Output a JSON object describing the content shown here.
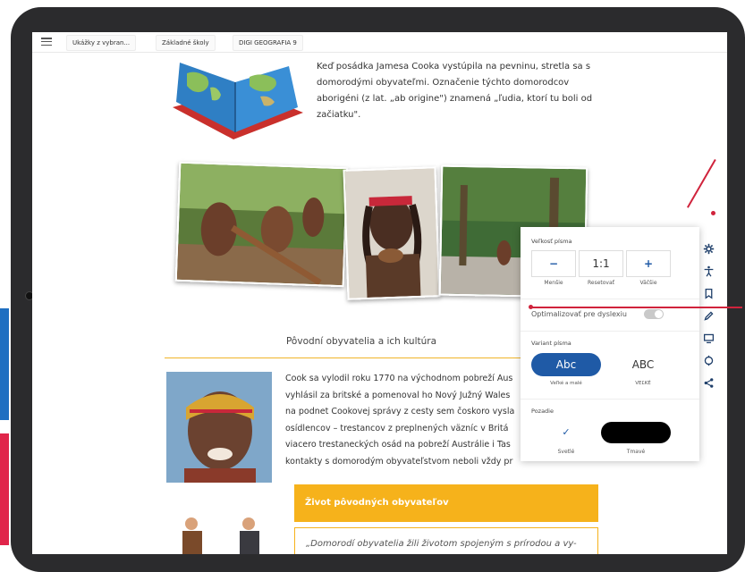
{
  "topbar": {
    "tabs": [
      "Ukážky z vybran...",
      "Základné školy",
      "DIGI GEOGRAFIA 9"
    ]
  },
  "intro": {
    "text": "Keď posádka Jamesa Cooka vystúpila na pevninu, stretla sa s domorodými obyvateľmi. Označenie týchto domorodcov aborigéni (z lat. „ab origine\") znamená „ľudia, ktorí tu boli od začiatku\"."
  },
  "section": {
    "title": "Pôvodní obyvatelia a ich kultúra",
    "body_lines": [
      "Cook sa vylodil roku 1770 na východnom pobreží Aus",
      "vyhlásil za britské a pomenoval ho Nový Južný Wales",
      "na podnet Cookovej správy z cesty sem čoskoro vysla",
      "osídlencov – trestancov z preplnených väzníc v Britá",
      "viacero trestaneckých osád na pobreží Austrálie i Tas",
      "kontakty s domorodým obyvateľstvom neboli vždy pr"
    ]
  },
  "highlight": {
    "title": "Život pôvodných obyvateľov",
    "quote": "„Domorodí obyvatelia žili životom spojeným s prírodou a vy-"
  },
  "settings_panel": {
    "font_size_label": "Veľkosť písma",
    "decrease_symbol": "−",
    "reset_value": "1:1",
    "increase_symbol": "+",
    "decrease_caption": "Menšie",
    "reset_caption": "Resetovať",
    "increase_caption": "Väčšie",
    "dyslexia_label": "Optimalizovať pre dyslexiu",
    "dyslexia_enabled": false,
    "font_variant_label": "Variant písma",
    "variant_lower": "Abc",
    "variant_upper": "ABC",
    "variant_lower_caption": "Veľké a malé",
    "variant_upper_caption": "VEĽKÉ",
    "background_label": "Pozadie",
    "bg_light_check": "✓",
    "bg_light_caption": "Svetlé",
    "bg_dark_caption": "Tmavé"
  },
  "toolbar": {
    "icons": [
      "gear-icon",
      "accessibility-icon",
      "bookmark-icon",
      "pencil-icon",
      "screen-icon",
      "target-icon",
      "share-icon"
    ]
  },
  "colors": {
    "accent_blue": "#1f5aa6",
    "highlight_orange": "#f6b21b",
    "annotation_red": "#d0233c"
  }
}
